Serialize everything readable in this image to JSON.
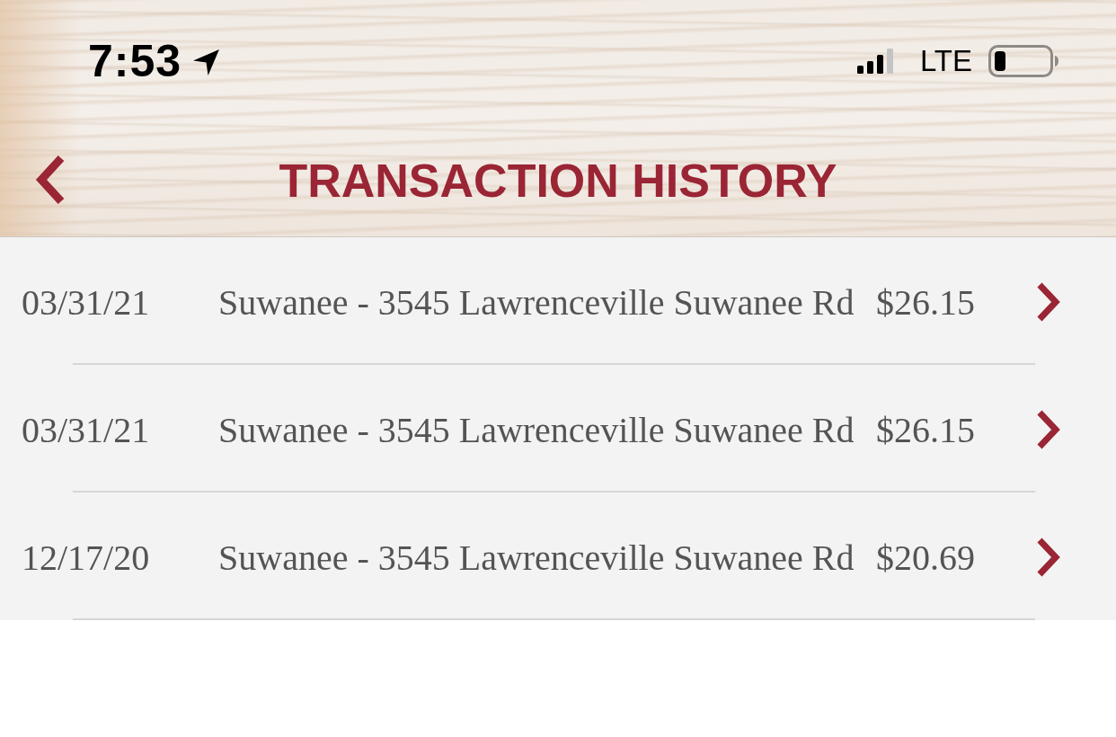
{
  "status_bar": {
    "time": "7:53",
    "network": "LTE"
  },
  "header": {
    "title": "TRANSACTION HISTORY"
  },
  "transactions": [
    {
      "date": "03/31/21",
      "location": "Suwanee - 3545 Lawrenceville Suwanee Rd",
      "amount": "$26.15"
    },
    {
      "date": "03/31/21",
      "location": "Suwanee - 3545 Lawrenceville Suwanee Rd",
      "amount": "$26.15"
    },
    {
      "date": "12/17/20",
      "location": "Suwanee - 3545 Lawrenceville Suwanee Rd",
      "amount": "$20.69"
    }
  ]
}
